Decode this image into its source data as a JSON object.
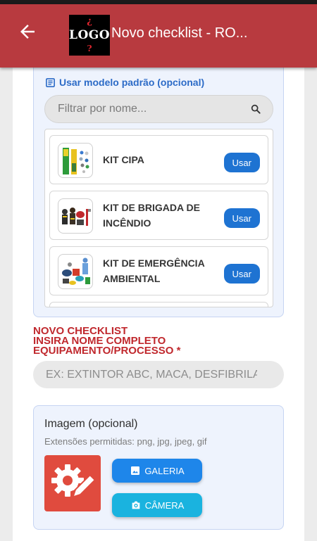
{
  "app_bar": {
    "title": "Novo checklist - RO...",
    "logo_text": "LOGO",
    "logo_marks": [
      "¿",
      "?"
    ]
  },
  "model_section": {
    "title": "Usar modelo padrão (opcional)",
    "filter_placeholder": "Filtrar por nome...",
    "items": [
      {
        "name": "KIT CIPA",
        "button": "Usar"
      },
      {
        "name": "KIT DE BRIGADA DE INCÊNDIO",
        "button": "Usar"
      },
      {
        "name": "KIT DE EMERGÊNCIA AMBIENTAL",
        "button": "Usar"
      }
    ]
  },
  "new_checklist": {
    "line1": "NOVO CHECKLIST",
    "line2": "INSIRA NOME COMPLETO",
    "line3": "EQUIPAMENTO/PROCESSO",
    "required_mark": "*",
    "name_placeholder": "EX: EXTINTOR ABC, MACA, DESFIBRILADOR"
  },
  "image_section": {
    "title": "Imagem (opcional)",
    "subtitle": "Extensões permitidas: png, jpg, jpeg, gif",
    "gallery_button": "GALERIA",
    "camera_button": "CÂMERA"
  },
  "colors": {
    "app_bar": "#b83a3f",
    "primary_blue": "#1e73d2",
    "required_red": "#c0282d",
    "preview_bg": "#e04b3e"
  },
  "icons": {
    "back": "arrow-left-icon",
    "model": "list-icon",
    "search": "search-icon",
    "gallery": "image-icon",
    "camera": "camera-icon",
    "preview": "gear-pencil-icon"
  }
}
